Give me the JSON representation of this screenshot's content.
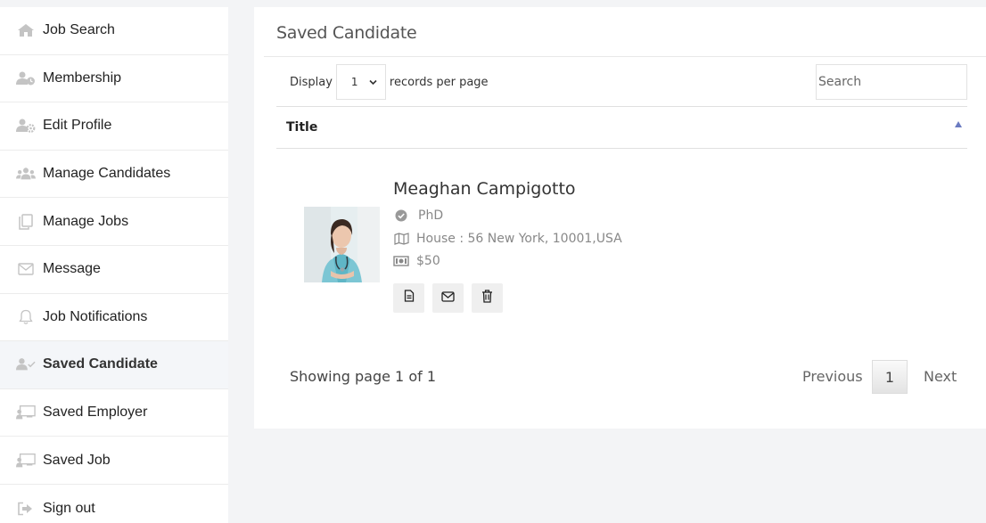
{
  "sidebar": {
    "items": [
      {
        "label": "Job Search",
        "icon": "home-icon"
      },
      {
        "label": "Membership",
        "icon": "user-clock-icon"
      },
      {
        "label": "Edit Profile",
        "icon": "user-gear-icon"
      },
      {
        "label": "Manage Candidates",
        "icon": "users-icon"
      },
      {
        "label": "Manage Jobs",
        "icon": "copy-icon"
      },
      {
        "label": "Message",
        "icon": "envelope-icon"
      },
      {
        "label": "Job Notifications",
        "icon": "bell-icon"
      },
      {
        "label": "Saved Candidate",
        "icon": "user-check-icon",
        "active": true
      },
      {
        "label": "Saved Employer",
        "icon": "chalkboard-user-icon"
      },
      {
        "label": "Saved Job",
        "icon": "chalkboard-user-icon"
      },
      {
        "label": "Sign out",
        "icon": "sign-out-icon"
      }
    ]
  },
  "main": {
    "title": "Saved Candidate",
    "display_label": "Display",
    "records_value": "1",
    "records_suffix": "records per page",
    "search_placeholder": "Search",
    "table": {
      "column_title": "Title"
    },
    "candidate": {
      "name": "Meaghan Campigotto",
      "degree": "PhD",
      "address": "House : 56 New York, 10001,USA",
      "rate": "$50",
      "actions": [
        "file-icon",
        "envelope-icon",
        "trash-icon"
      ]
    },
    "pagination": {
      "showing": "Showing page 1 of 1",
      "previous": "Previous",
      "current": "1",
      "next": "Next"
    }
  },
  "colors": {
    "accent": "#6b7bc1",
    "sidebar_icon": "#c4c4c4",
    "active_bg": "#f4f6f9"
  }
}
